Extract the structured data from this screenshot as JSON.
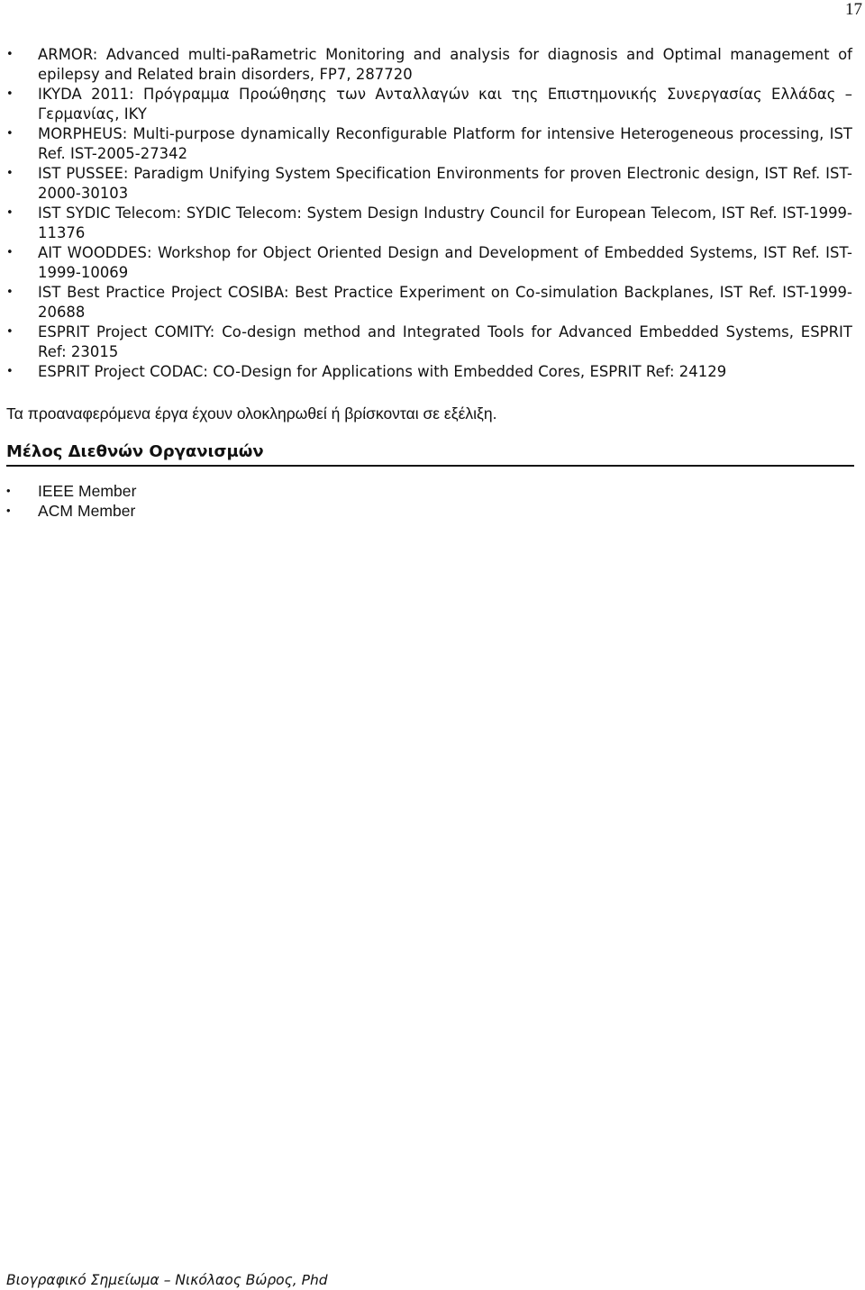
{
  "page": {
    "number": "17"
  },
  "projects": {
    "items": [
      "ARMOR: Advanced multi-paRametric Monitoring and analysis for diagnosis and Optimal management of epilepsy and Related brain disorders, FP7, 287720",
      "IKYDA 2011: Πρόγραμμα Προώθησης των Ανταλλαγών και της Επιστημονικής Συνεργασίας Ελλάδας – Γερμανίας, IKY",
      "MORPHEUS: Multi-purpose dynamically Reconfigurable Platform for intensive Heterogeneous processing, IST Ref. IST-2005-27342",
      "IST PUSSEE: Paradigm Unifying System Specification Environments for proven Electronic design, IST Ref. IST-2000-30103",
      "IST SYDIC Telecom: SYDIC Telecom: System Design Industry Council for European Telecom, IST Ref.  IST-1999-11376",
      "AIT WOODDES: Workshop for Object Oriented Design and Development of Embedded Systems, IST Ref.  IST-1999-10069",
      "IST Best Practice Project COSIBA: Best Practice Experiment on Co-simulation Backplanes, IST Ref. IST-1999-20688",
      "ESPRIT Project COMITY: Co-design method and Integrated Tools for Advanced Embedded Systems, ESPRIT Ref: 23015",
      "ESPRIT Project CODAC: CO-Design for Applications with Embedded Cores, ESPRIT Ref: 24129"
    ],
    "bullet_glyph": "•"
  },
  "summary": "Τα προαναφερόμενα έργα έχουν ολοκληρωθεί ή βρίσκονται σε εξέλιξη.",
  "memberships": {
    "heading": "Μέλος Διεθνών Οργανισμών",
    "items": [
      "IEEE Member",
      "ACM Member"
    ]
  },
  "footer": "Βιογραφικό Σημείωμα – Νικόλαος Βώρος, Phd"
}
